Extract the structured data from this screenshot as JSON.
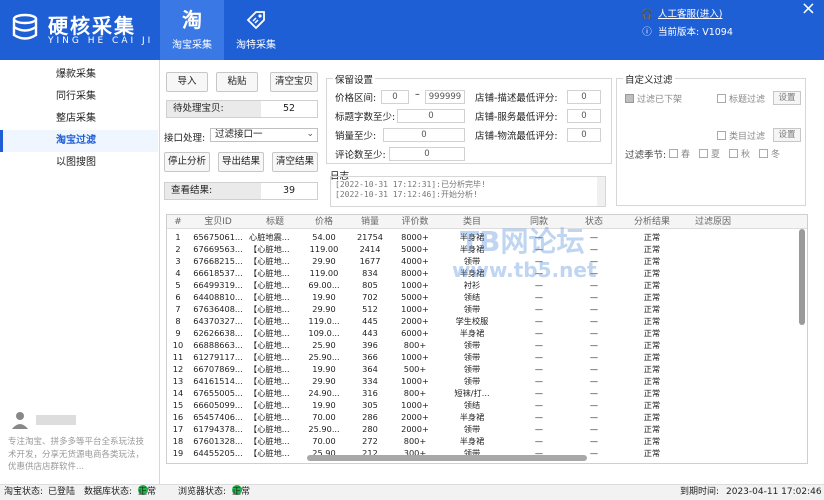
{
  "app": {
    "title": "硬核采集",
    "subtitle": "YING HE CAI JI",
    "brand_color": "#1f5fd6"
  },
  "top_tabs": [
    {
      "icon": "taobao-icon",
      "glyph": "淘",
      "label": "淘宝采集",
      "active": true
    },
    {
      "icon": "tag-icon",
      "glyph": "",
      "label": "淘特采集",
      "active": false
    }
  ],
  "header": {
    "service_link": "人工客服(进入)",
    "version": "当前版本: V1094",
    "close_glyph": "×"
  },
  "sidebar": {
    "items": [
      {
        "label": "爆款采集"
      },
      {
        "label": "同行采集"
      },
      {
        "label": "整店采集"
      },
      {
        "label": "淘宝过滤",
        "active": true
      },
      {
        "label": "以图搜图"
      }
    ],
    "description": "专注淘宝、拼多多等平台全系玩法技术开发，分享无货源电商各类玩法，优惠供店店群软件..."
  },
  "actions": {
    "import": "导入",
    "paste": "粘贴",
    "clear_items": "清空宝贝",
    "pending_label": "待处理宝贝:",
    "pending_value": "52",
    "interface_label": "接口处理:",
    "interface_value": "过滤接口一",
    "stop": "停止分析",
    "export": "导出结果",
    "clear_results": "清空结果",
    "results_label": "查看结果:",
    "results_value": "39"
  },
  "retain": {
    "title": "保留设置",
    "price_label": "价格区间:",
    "price_min": "0",
    "price_sep": "–",
    "price_max": "999999",
    "title_chars_label": "标题字数至少:",
    "title_chars": "0",
    "sales_label": "销量至少:",
    "sales": "0",
    "reviews_label": "评论数至少:",
    "reviews": "0",
    "desc_score_label": "店铺-描述最低评分:",
    "desc_score": "0",
    "service_score_label": "店铺-服务最低评分:",
    "service_score": "0",
    "logistics_score_label": "店铺-物流最低评分:",
    "logistics_score": "0"
  },
  "custom_filter": {
    "title": "自定义过滤",
    "filter_removed": "过滤已下架",
    "title_filter": "标题过滤",
    "title_settings": "设置",
    "category_filter": "类目过滤",
    "category_settings": "设置",
    "season_label": "过滤季节:",
    "seasons": [
      "春",
      "夏",
      "秋",
      "冬"
    ]
  },
  "log": {
    "title": "日志",
    "lines": [
      "[2022-10-31 17:12:31]:已分析完毕!",
      "[2022-10-31 17:12:46]:开始分析!"
    ]
  },
  "table": {
    "columns": [
      "#",
      "宝贝ID",
      "标题",
      "价格",
      "销量",
      "评价数",
      "类目",
      "同款",
      "状态",
      "分析结果",
      "过滤原因"
    ],
    "rows": [
      [
        "1",
        "65675061...",
        "心脏地震...",
        "54.00",
        "21754",
        "8000+",
        "半身裙",
        "—",
        "—",
        "正常",
        ""
      ],
      [
        "2",
        "67669563...",
        "【心脏地...",
        "119.00",
        "2414",
        "5000+",
        "半身裙",
        "—",
        "—",
        "正常",
        ""
      ],
      [
        "3",
        "67668215...",
        "【心脏地...",
        "29.90",
        "1677",
        "4000+",
        "领带",
        "—",
        "—",
        "正常",
        ""
      ],
      [
        "4",
        "66618537...",
        "【心脏地...",
        "119.00",
        "834",
        "8000+",
        "半身裙",
        "—",
        "—",
        "正常",
        ""
      ],
      [
        "5",
        "66499319...",
        "【心脏地...",
        "69.00...",
        "805",
        "1000+",
        "衬衫",
        "—",
        "—",
        "正常",
        ""
      ],
      [
        "6",
        "64408810...",
        "【心脏地...",
        "19.90",
        "702",
        "5000+",
        "领结",
        "—",
        "—",
        "正常",
        ""
      ],
      [
        "7",
        "67636408...",
        "【心脏地...",
        "29.90",
        "512",
        "1000+",
        "领带",
        "—",
        "—",
        "正常",
        ""
      ],
      [
        "8",
        "64370327...",
        "【心脏地...",
        "119.0...",
        "445",
        "2000+",
        "学生校服",
        "—",
        "—",
        "正常",
        ""
      ],
      [
        "9",
        "62626638...",
        "【心脏地...",
        "109.0...",
        "443",
        "6000+",
        "半身裙",
        "—",
        "—",
        "正常",
        ""
      ],
      [
        "10",
        "66888663...",
        "【心脏地...",
        "25.90",
        "396",
        "800+",
        "领带",
        "—",
        "—",
        "正常",
        ""
      ],
      [
        "11",
        "61279117...",
        "【心脏地...",
        "25.90...",
        "366",
        "1000+",
        "领带",
        "—",
        "—",
        "正常",
        ""
      ],
      [
        "12",
        "66707869...",
        "【心脏地...",
        "19.90",
        "364",
        "500+",
        "领带",
        "—",
        "—",
        "正常",
        ""
      ],
      [
        "13",
        "64161514...",
        "【心脏地...",
        "29.90",
        "334",
        "1000+",
        "领带",
        "—",
        "—",
        "正常",
        ""
      ],
      [
        "14",
        "67655005...",
        "【心脏地...",
        "24.90...",
        "316",
        "800+",
        "短袜/打...",
        "—",
        "—",
        "正常",
        ""
      ],
      [
        "15",
        "66605099...",
        "【心脏地...",
        "19.90",
        "305",
        "1000+",
        "领结",
        "—",
        "—",
        "正常",
        ""
      ],
      [
        "16",
        "65457406...",
        "【心脏地...",
        "70.00",
        "286",
        "2000+",
        "半身裙",
        "—",
        "—",
        "正常",
        ""
      ],
      [
        "17",
        "61794378...",
        "【心脏地...",
        "25.90...",
        "280",
        "2000+",
        "领带",
        "—",
        "—",
        "正常",
        ""
      ],
      [
        "18",
        "67601328...",
        "【心脏地...",
        "70.00",
        "272",
        "800+",
        "半身裙",
        "—",
        "—",
        "正常",
        ""
      ],
      [
        "19",
        "64455205...",
        "【心脏地...",
        "25.90",
        "212",
        "300+",
        "领带",
        "—",
        "—",
        "正常",
        ""
      ]
    ]
  },
  "watermark": {
    "line1": "TB网论坛",
    "line2": "www.tb5.net"
  },
  "status_bar": {
    "taobao_label": "淘宝状态:",
    "taobao_value": "已登陆",
    "db_label": "数据库状态:",
    "db_value": "正常",
    "browser_label": "浏览器状态:",
    "browser_value": "正常",
    "expiry_label": "到期时间:",
    "expiry_value": "2023-04-11 17:02:46",
    "ok_color": "#22b14c"
  }
}
